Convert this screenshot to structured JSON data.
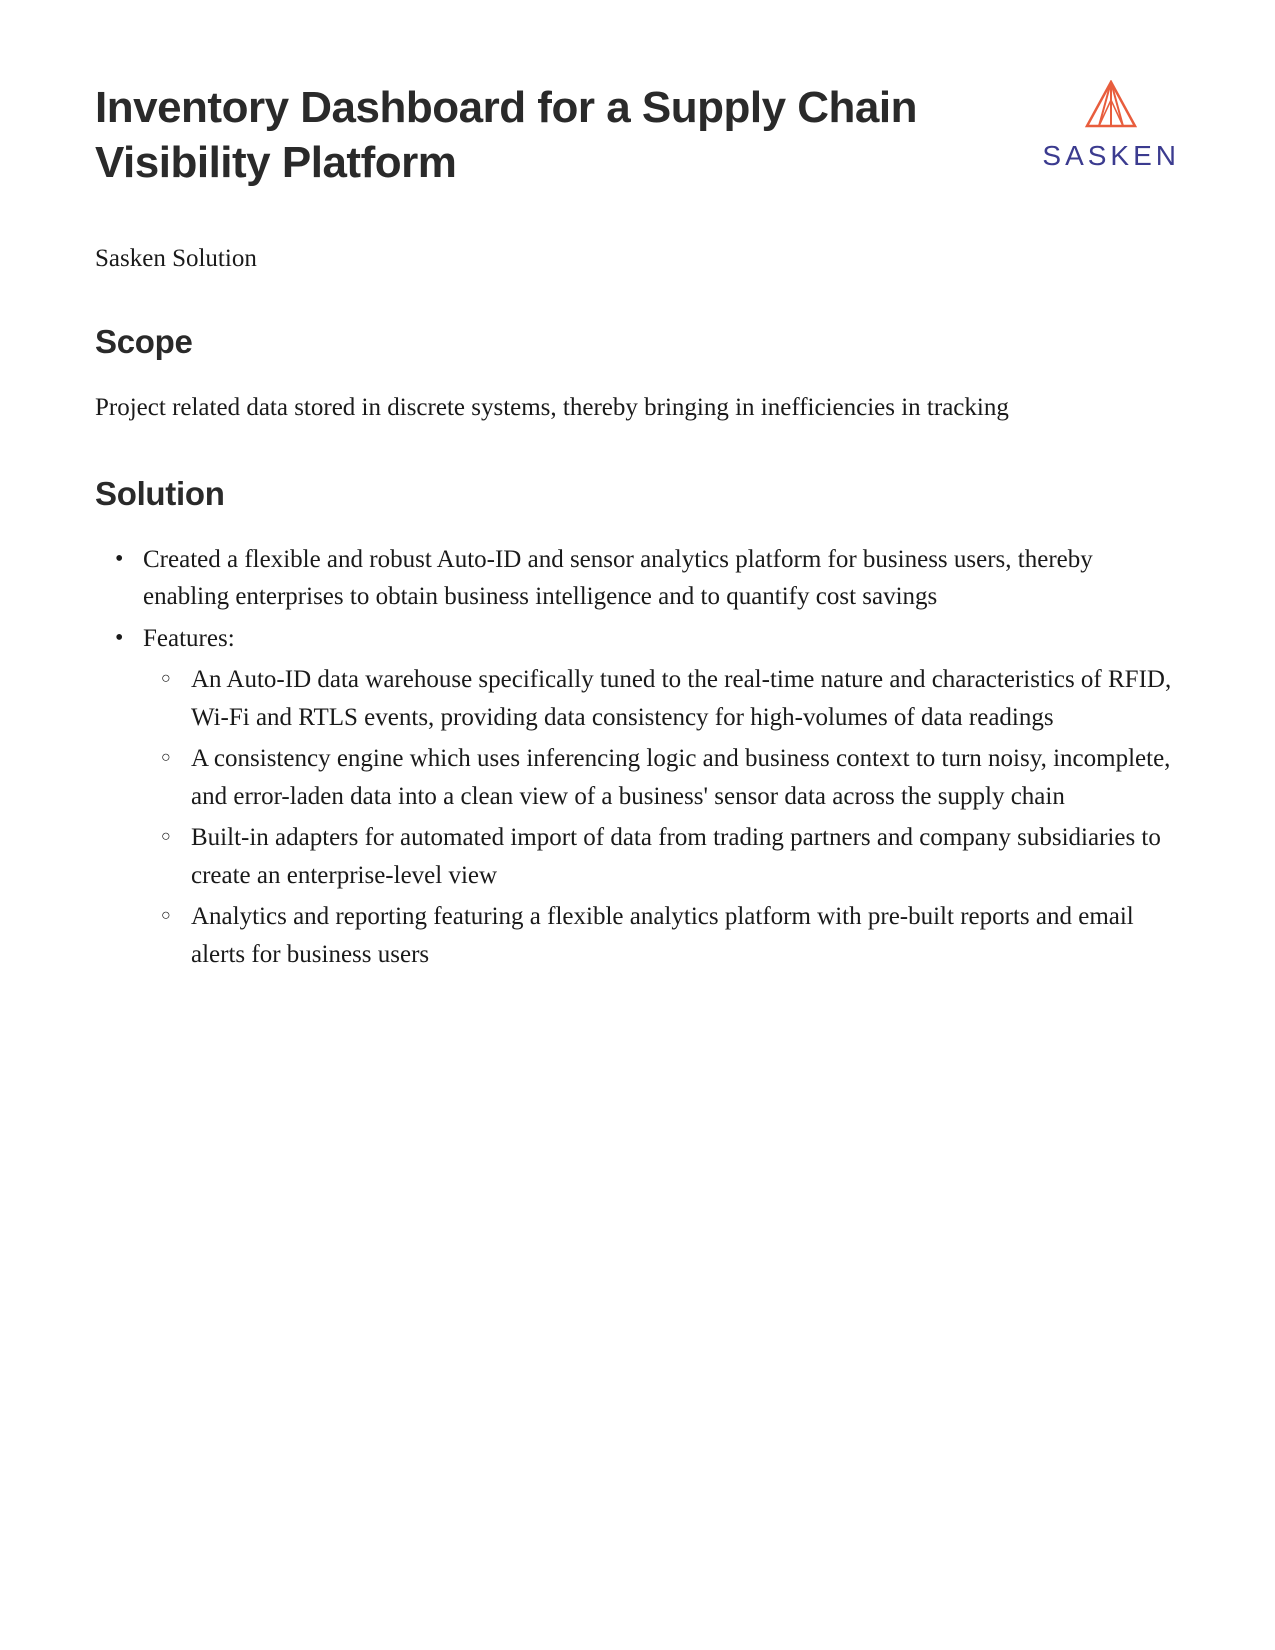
{
  "title": "Inventory Dashboard for a Supply Chain Visibility Platform",
  "logo_text": "SASKEN",
  "subtitle": "Sasken Solution",
  "sections": {
    "scope": {
      "heading": "Scope",
      "text": "Project related data stored in discrete systems, thereby bringing in inefficiencies in tracking"
    },
    "solution": {
      "heading": "Solution",
      "bullets": [
        "Created a flexible and robust Auto-ID and sensor analytics platform for business users, thereby enabling enterprises to obtain business intelligence and to quantify cost savings",
        "Features:"
      ],
      "sub_bullets": [
        "An Auto-ID data warehouse specifically tuned to the real-time nature and characteristics of RFID, Wi-Fi and RTLS events, providing data consistency for high-volumes of data readings",
        "A consistency engine which uses inferencing logic and business context to turn noisy, incomplete, and error-laden data into a clean view of a business' sensor data across the supply chain",
        "Built-in adapters for automated import of data from trading partners and company subsidiaries to create an enterprise-level view",
        "Analytics and reporting featuring a flexible analytics platform with pre-built reports and email alerts for business users"
      ]
    }
  }
}
